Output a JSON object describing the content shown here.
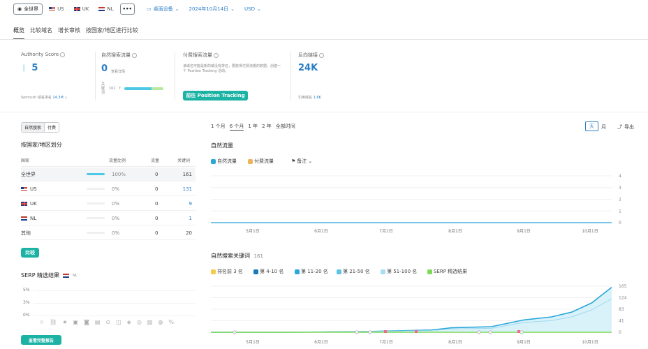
{
  "topbar": {
    "database": "全世界",
    "countries": [
      "US",
      "UK",
      "NL"
    ],
    "more": "•••",
    "device": "桌面设备",
    "date": "2024年10月14日",
    "currency": "USD"
  },
  "tabs": [
    "概览",
    "比较域名",
    "增长审核",
    "按国家/地区进行比较"
  ],
  "kpis": {
    "authority": {
      "label": "Authority Score",
      "value": "5",
      "footer_label": "Semrush 域名排名",
      "footer_value": "14.3M",
      "footer_arrow": "↓"
    },
    "organic": {
      "label": "自然搜索流量",
      "value": "0",
      "sub": "查看详情",
      "kw_label": "关键词",
      "kw_value": "161",
      "kw_arrow": "↑"
    },
    "paid": {
      "label": "付费搜索流量",
      "desc": "该域名可能是新的或没有排名，要获得付费流量的数据，创建一个 Position Tracking 活动。",
      "button": "前往 Position Tracking"
    },
    "backlinks": {
      "label": "反向链接",
      "value": "24K",
      "footer_label": "引用域名",
      "footer_value": "1.6K"
    }
  },
  "left": {
    "toggle": [
      "自然搜索",
      "付费"
    ],
    "country_title": "按国家/地区划分",
    "columns": [
      "国家",
      "流量比例",
      "流量",
      "关键词"
    ],
    "rows": [
      {
        "name": "全世界",
        "share": "100%",
        "traffic": "0",
        "keywords": "161",
        "flag": ""
      },
      {
        "name": "US",
        "share": "0%",
        "traffic": "0",
        "keywords": "131",
        "flag": "us"
      },
      {
        "name": "UK",
        "share": "0%",
        "traffic": "0",
        "keywords": "9",
        "flag": "uk"
      },
      {
        "name": "NL",
        "share": "0%",
        "traffic": "0",
        "keywords": "1",
        "flag": "nl"
      },
      {
        "name": "其他",
        "share": "0%",
        "traffic": "0",
        "keywords": "20",
        "flag": ""
      }
    ],
    "compare_btn": "比较",
    "serp_title": "SERP 精选结果",
    "serp_flag_label": "NL",
    "serp_y": [
      "5%",
      "3%",
      "0%"
    ],
    "serp_btn": "查看完整报告"
  },
  "right": {
    "ranges": [
      "1 个月",
      "6 个月",
      "1 年",
      "2 年",
      "全部时间"
    ],
    "active_range": "6 个月",
    "day": "天",
    "month": "月",
    "export": "导出",
    "traffic_title": "自然流量",
    "traffic_legend": [
      "自然流量",
      "付费流量",
      "备注"
    ],
    "kw_title": "自然搜索关键词",
    "kw_count": "161",
    "kw_legend": [
      "排名前 3 名",
      "第 4-10 名",
      "第 11-20 名",
      "第 21-50 名",
      "第 51-100 名",
      "SERP 精选结果"
    ]
  },
  "colors": {
    "accent": "#2b7ec6",
    "green": "#1db3a4",
    "bar": "#4dc9e6",
    "orange": "#f0b15b",
    "pos1": "#f7c948",
    "pos2": "#1a79b9",
    "pos3": "#2aa7d9",
    "pos4": "#5ec3e6",
    "pos5": "#a7dff0",
    "serp": "#7ed957"
  },
  "chart_data": [
    {
      "type": "line",
      "title": "自然流量",
      "x": [
        "5月1日",
        "6月1日",
        "7月1日",
        "8月1日",
        "9月1日",
        "10月1日"
      ],
      "ylim": [
        0,
        4
      ],
      "yticks": [
        "4",
        "3",
        "2",
        "1",
        "0"
      ],
      "series": [
        {
          "name": "自然流量",
          "values": [
            0,
            0,
            0,
            0,
            0,
            0
          ]
        }
      ]
    },
    {
      "type": "area",
      "title": "自然搜索关键词",
      "x": [
        "5月1日",
        "6月1日",
        "7月1日",
        "8月1日",
        "9月1日",
        "10月1日"
      ],
      "ylim": [
        0,
        165
      ],
      "yticks": [
        "165",
        "124",
        "83",
        "41",
        "0"
      ],
      "series": [
        {
          "name": "第 51-100 名",
          "points": [
            [
              0,
              0
            ],
            [
              0.2,
              0
            ],
            [
              0.4,
              3
            ],
            [
              0.55,
              6
            ],
            [
              0.6,
              12
            ],
            [
              0.7,
              14
            ],
            [
              0.78,
              35
            ],
            [
              0.85,
              42
            ],
            [
              0.9,
              55
            ],
            [
              0.95,
              80
            ],
            [
              1.0,
              120
            ]
          ]
        },
        {
          "name": "第 21-50 名",
          "points": [
            [
              0,
              0
            ],
            [
              0.2,
              0
            ],
            [
              0.4,
              3
            ],
            [
              0.55,
              8
            ],
            [
              0.6,
              16
            ],
            [
              0.7,
              20
            ],
            [
              0.78,
              44
            ],
            [
              0.85,
              55
            ],
            [
              0.9,
              72
            ],
            [
              0.95,
              105
            ],
            [
              1.0,
              161
            ]
          ]
        }
      ]
    }
  ]
}
